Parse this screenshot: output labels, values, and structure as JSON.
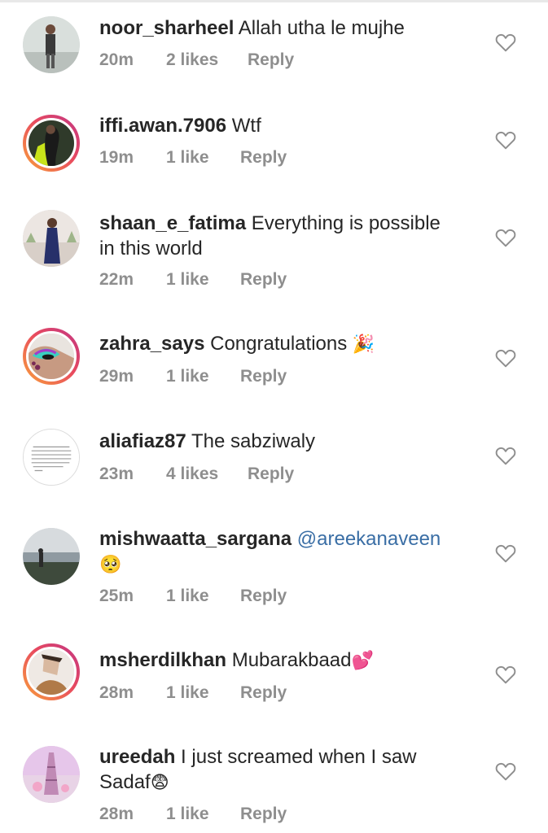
{
  "comments": [
    {
      "username": "noor_sharheel",
      "text": "Allah utha le mujhe",
      "time": "20m",
      "likes": "2 likes",
      "reply": "Reply"
    },
    {
      "username": "iffi.awan.7906",
      "text": "Wtf",
      "time": "19m",
      "likes": "1 like",
      "reply": "Reply"
    },
    {
      "username": "shaan_e_fatima",
      "text": "Everything is possible",
      "text2": "in this world",
      "time": "22m",
      "likes": "1 like",
      "reply": "Reply"
    },
    {
      "username": "zahra_says",
      "text": "Congratulations",
      "emoji": "🎉",
      "time": "29m",
      "likes": "1 like",
      "reply": "Reply"
    },
    {
      "username": "aliafiaz87",
      "text": "The sabziwaly",
      "time": "23m",
      "likes": "4 likes",
      "reply": "Reply"
    },
    {
      "username": "mishwaatta_sargana",
      "mention": "@areekanaveen",
      "emoji": "🥺",
      "time": "25m",
      "likes": "1 like",
      "reply": "Reply"
    },
    {
      "username": "msherdilkhan",
      "text": "Mubarakbaad",
      "emoji": "💕",
      "time": "28m",
      "likes": "1 like",
      "reply": "Reply"
    },
    {
      "username": "ureedah",
      "text": "I just screamed when I saw",
      "text2": "Sadaf",
      "emoji": "😨",
      "time": "28m",
      "likes": "1 like",
      "reply": "Reply"
    }
  ],
  "icons": {
    "like": "heart-outline-icon"
  },
  "colors": {
    "meta_text": "#8e8e8e",
    "story_ring_start": "#f9a23a",
    "story_ring_end": "#c13584",
    "mention": "#3a6ea5"
  }
}
